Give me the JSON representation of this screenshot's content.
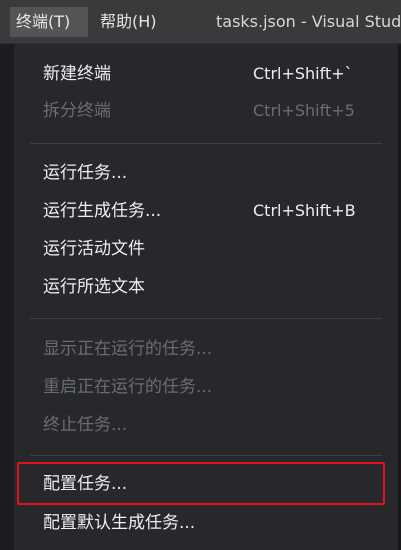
{
  "menubar": {
    "terminal_label": "终端(T)",
    "help_label": "帮助(H)",
    "window_title": "tasks.json - Visual Studio"
  },
  "dropdown": {
    "items": [
      {
        "label": "新建终端",
        "shortcut": "Ctrl+Shift+`",
        "enabled": true
      },
      {
        "label": "拆分终端",
        "shortcut": "Ctrl+Shift+5",
        "enabled": false
      },
      {
        "label": "运行任务...",
        "shortcut": "",
        "enabled": true
      },
      {
        "label": "运行生成任务...",
        "shortcut": "Ctrl+Shift+B",
        "enabled": true
      },
      {
        "label": "运行活动文件",
        "shortcut": "",
        "enabled": true
      },
      {
        "label": "运行所选文本",
        "shortcut": "",
        "enabled": true
      },
      {
        "label": "显示正在运行的任务...",
        "shortcut": "",
        "enabled": false
      },
      {
        "label": "重启正在运行的任务...",
        "shortcut": "",
        "enabled": false
      },
      {
        "label": "终止任务...",
        "shortcut": "",
        "enabled": false
      },
      {
        "label": "配置任务...",
        "shortcut": "",
        "enabled": true,
        "highlighted": true
      },
      {
        "label": "配置默认生成任务...",
        "shortcut": "",
        "enabled": true
      }
    ]
  },
  "colors": {
    "highlight_border": "#e0121e",
    "menu_background": "#26282b",
    "disabled_text": "#6b6d71"
  }
}
